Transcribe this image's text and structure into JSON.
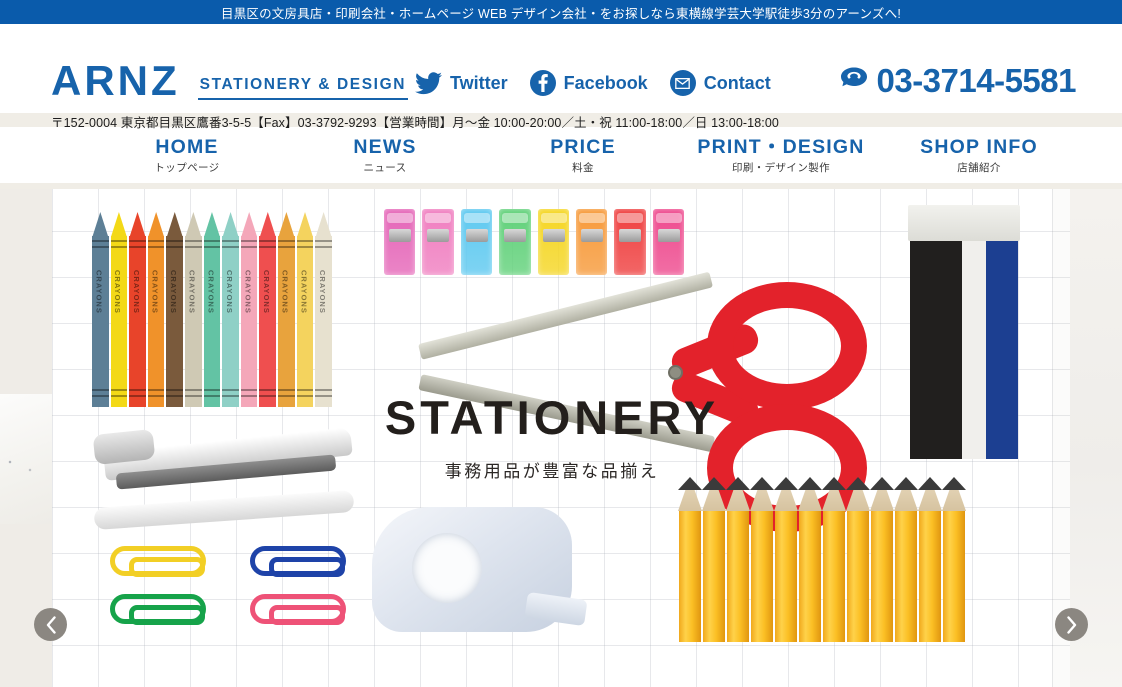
{
  "topbar": {
    "text": "目黒区の文房具店・印刷会社・ホームページ WEB デザイン会社・をお探しなら東横線学芸大学駅徒歩3分のアーンズへ!"
  },
  "header": {
    "logo": "ARNZ",
    "logo_tagline": "STATIONERY & DESIGN",
    "social": [
      {
        "label": "Twitter",
        "icon": "twitter-icon"
      },
      {
        "label": "Facebook",
        "icon": "facebook-icon"
      },
      {
        "label": "Contact",
        "icon": "mail-icon"
      }
    ],
    "phone": {
      "icon": "telephone-icon",
      "number": "03-3714-5581"
    },
    "address": "〒152-0004 東京都目黒区鷹番3-5-5【Fax】03-3792-9293【営業時間】月～金 10:00-20:00／土・祝 11:00-18:00／日 13:00-18:00"
  },
  "nav": {
    "items": [
      {
        "title": "HOME",
        "sub": "トップページ"
      },
      {
        "title": "NEWS",
        "sub": "ニュース"
      },
      {
        "title": "PRICE",
        "sub": "料金"
      },
      {
        "title": "PRINT・DESIGN",
        "sub": "印刷・デザイン製作"
      },
      {
        "title": "SHOP INFO",
        "sub": "店舗紹介"
      }
    ]
  },
  "hero": {
    "title": "STATIONERY",
    "subtitle": "事務用品が豊富な品揃え",
    "prev_label": "‹",
    "next_label": "›",
    "crayon_label": "CRAYONS",
    "crayon_colors": [
      "#5d7f96",
      "#f3d917",
      "#e8442a",
      "#f0922a",
      "#7a5a3c",
      "#cfc9b4",
      "#63c3a4",
      "#8fd0c6",
      "#f4a7b9",
      "#ef4f4f",
      "#e8a33d",
      "#f4d35e",
      "#e7e1cf"
    ],
    "clip_colors": [
      "#e566b8",
      "#f07ec0",
      "#5ec9f0",
      "#61d17a",
      "#f5d623",
      "#f79a3a",
      "#ef4040",
      "#ee4a8e"
    ],
    "paperclip_colors": [
      "#f2cf25",
      "#1e43a8",
      "#16a34a",
      "#ee5277"
    ],
    "pencil_count": 12
  },
  "colors": {
    "brand_blue": "#0a5bab",
    "logo_blue": "#1763ab",
    "beige": "#f0ede6",
    "arrow_gray": "#8b8781",
    "hero_title": "#231f1c"
  }
}
